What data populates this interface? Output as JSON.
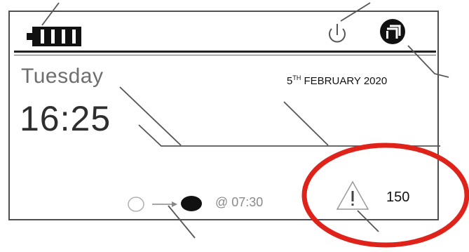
{
  "status_bar": {
    "battery_icon": "battery-icon",
    "power_icon": "power-icon",
    "app_logo_icon": "brand-logo-icon"
  },
  "day": "Tuesday",
  "time": "16:25",
  "date": {
    "prefix": "5",
    "suffix": "TH",
    "rest": " FEBRUARY 2020"
  },
  "alarm": {
    "text": "@ 07:30",
    "from_state_icon": "circle-empty-icon",
    "to_state_icon": "circle-filled-icon"
  },
  "warning": {
    "icon": "warning-triangle-icon",
    "count": "150",
    "highlight_color": "#e0231a"
  }
}
